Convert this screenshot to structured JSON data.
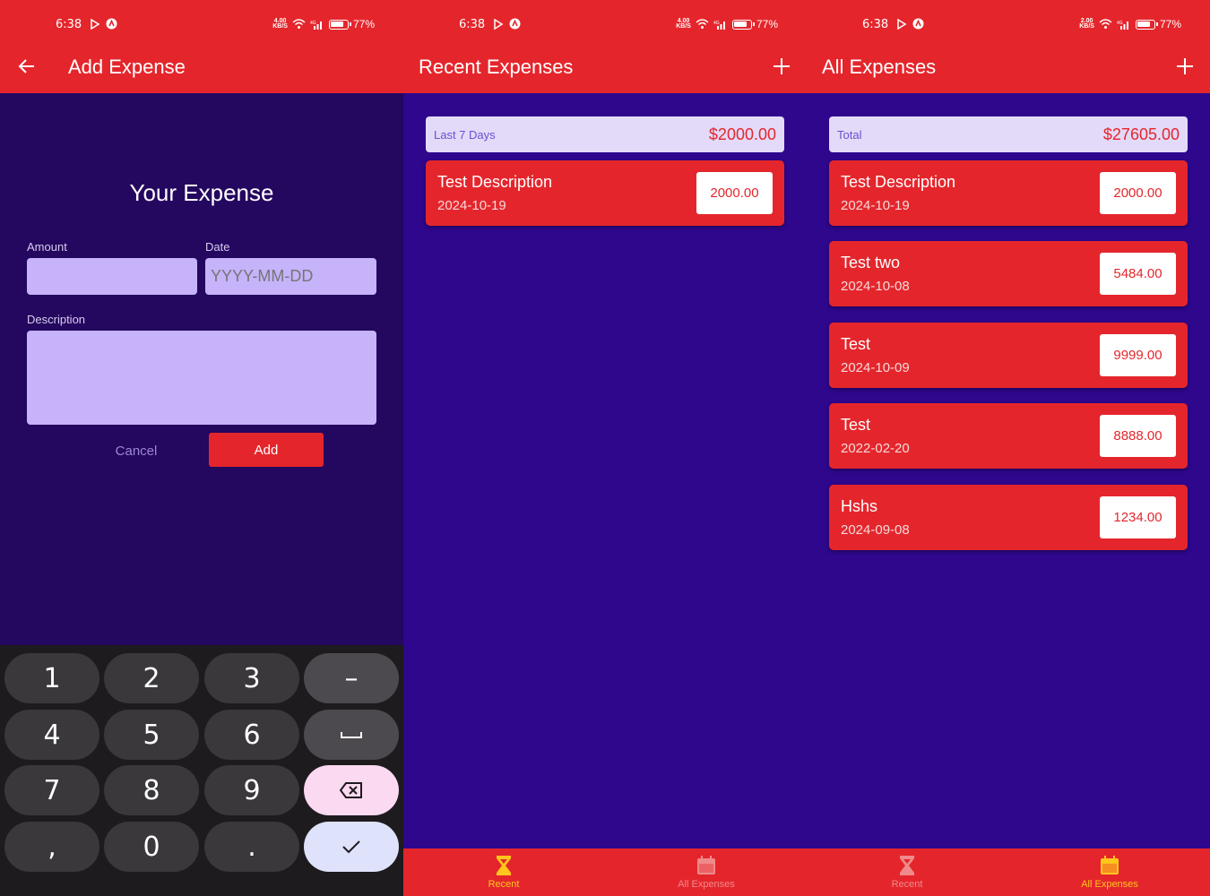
{
  "status_bar": {
    "time": "6:38",
    "battery": "77%",
    "speed_add": "4.00\nKB/S",
    "speed_recent": "4.00\nKB/S",
    "speed_all": "2.00\nKB/S"
  },
  "add_screen": {
    "title": "Add Expense",
    "heading": "Your Expense",
    "amount_label": "Amount",
    "amount_value": "",
    "date_label": "Date",
    "date_placeholder": "YYYY-MM-DD",
    "description_label": "Description",
    "description_value": "",
    "cancel_label": "Cancel",
    "add_label": "Add"
  },
  "keypad": {
    "keys": [
      "1",
      "2",
      "3",
      "–",
      "4",
      "5",
      "6",
      "␣",
      "7",
      "8",
      "9",
      "⌫",
      ",",
      "0",
      ".",
      "✓"
    ]
  },
  "recent_screen": {
    "title": "Recent Expenses",
    "summary_label": "Last 7 Days",
    "summary_total": "$2000.00",
    "expenses": [
      {
        "description": "Test Description",
        "date": "2024-10-19",
        "amount": "2000.00"
      }
    ],
    "nav": {
      "recent_label": "Recent",
      "all_label": "All Expenses"
    }
  },
  "all_screen": {
    "title": "All Expenses",
    "summary_label": "Total",
    "summary_total": "$27605.00",
    "expenses": [
      {
        "description": "Test Description",
        "date": "2024-10-19",
        "amount": "2000.00"
      },
      {
        "description": "Test two",
        "date": "2024-10-08",
        "amount": "5484.00"
      },
      {
        "description": "Test",
        "date": "2024-10-09",
        "amount": "9999.00"
      },
      {
        "description": "Test",
        "date": "2022-02-20",
        "amount": "8888.00"
      },
      {
        "description": "Hshs",
        "date": "2024-09-08",
        "amount": "1234.00"
      }
    ],
    "nav": {
      "recent_label": "Recent",
      "all_label": "All Expenses"
    }
  },
  "colors": {
    "primary_red": "#e4262c",
    "background_purple": "#2e078d",
    "form_background": "#24075f",
    "input_fill": "#c6b3fa",
    "active_nav": "#ffc61b"
  },
  "icons": {
    "back": "arrow-left-icon",
    "add": "plus-icon",
    "recent_tab": "hourglass-icon",
    "all_tab": "calendar-icon"
  }
}
